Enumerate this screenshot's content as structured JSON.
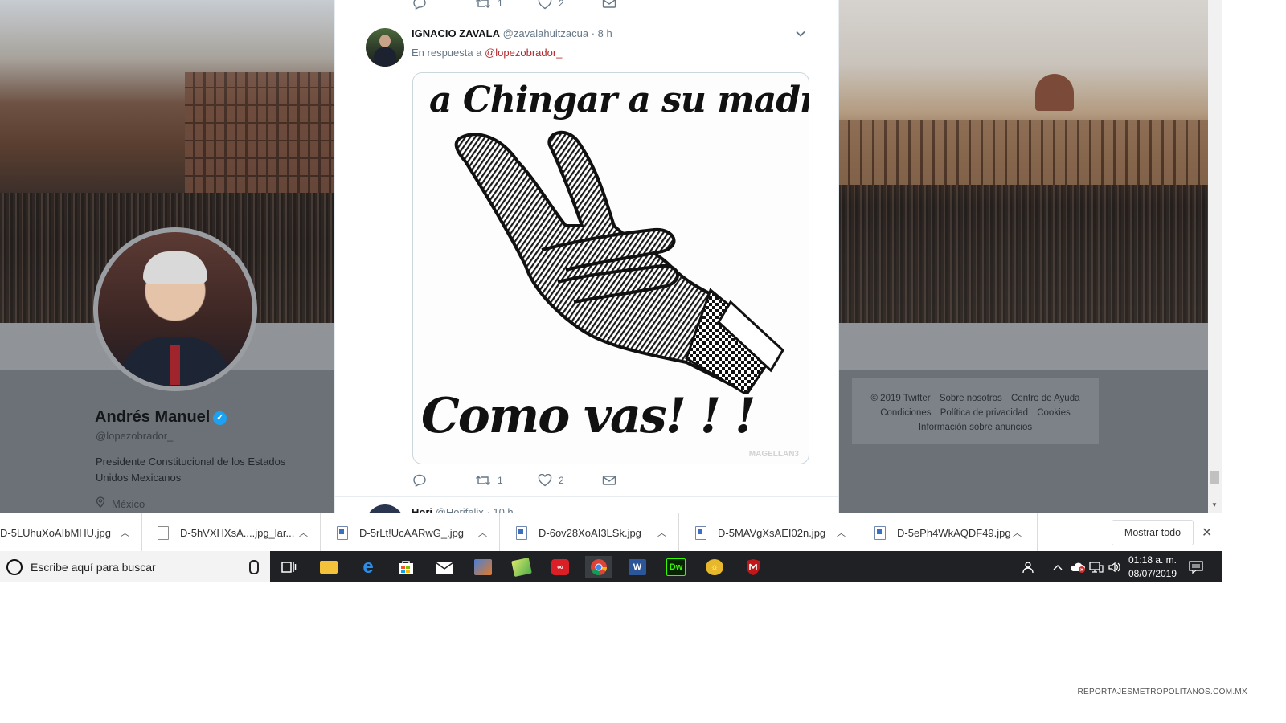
{
  "profile": {
    "name": "Andrés Manuel",
    "verified_badge": "✓",
    "handle": "@lopezobrador_",
    "bio": "Presidente Constitucional de los Estados Unidos Mexicanos",
    "location": "México"
  },
  "footer": {
    "links": [
      "© 2019 Twitter",
      "Sobre nosotros",
      "Centro de Ayuda",
      "Condiciones",
      "Política de privacidad",
      "Cookies",
      "Información sobre anuncios"
    ]
  },
  "prev_tweet_actions": {
    "retweets": "1",
    "likes": "2"
  },
  "tweet": {
    "author_name": "IGNACIO ZAVALA",
    "author_handle": "@zavalahuitzacua",
    "time": "· 8 h",
    "reply_prefix": "En respuesta a",
    "reply_mention": "@lopezobrador_",
    "meme_top_text": "a Chingar a su madre,,,",
    "meme_bottom_text": "Como vas! ! !",
    "meme_watermark": "MAGELLAN3",
    "retweets": "1",
    "likes": "2"
  },
  "next_tweet": {
    "author_name": "Hori",
    "author_handle": "@Horifelix",
    "time": "· 10 h"
  },
  "downloads": {
    "items": [
      {
        "name": "D-5LUhuXoAIbMHU.jpg",
        "icon": "image-file-icon"
      },
      {
        "name": "D-5hVXHXsA....jpg_lar...",
        "icon": "blank-file-icon"
      },
      {
        "name": "D-5rLt!UcAARwG_.jpg",
        "icon": "image-file-icon"
      },
      {
        "name": "D-6ov28XoAI3LSk.jpg",
        "icon": "image-file-icon"
      },
      {
        "name": "D-5MAVgXsAEI02n.jpg",
        "icon": "image-file-icon"
      },
      {
        "name": "D-5ePh4WkAQDF49.jpg",
        "icon": "image-file-icon"
      }
    ],
    "show_all": "Mostrar todo"
  },
  "taskbar": {
    "search_placeholder": "Escribe aquí para buscar",
    "apps": [
      "task-view",
      "file-explorer",
      "edge",
      "store",
      "mail",
      "media-app",
      "notes-app",
      "creative-cloud",
      "chrome",
      "word",
      "dreamweaver",
      "sun-app",
      "mcafee"
    ],
    "clock_time": "01:18 a. m.",
    "clock_date": "08/07/2019"
  },
  "watermark_site": "REPORTAJESMETROPOLITANOS.COM.MX",
  "colors": {
    "twitter_blue": "#1da1f2",
    "mention_red": "#b3282d",
    "taskbar": "#1f2124"
  }
}
